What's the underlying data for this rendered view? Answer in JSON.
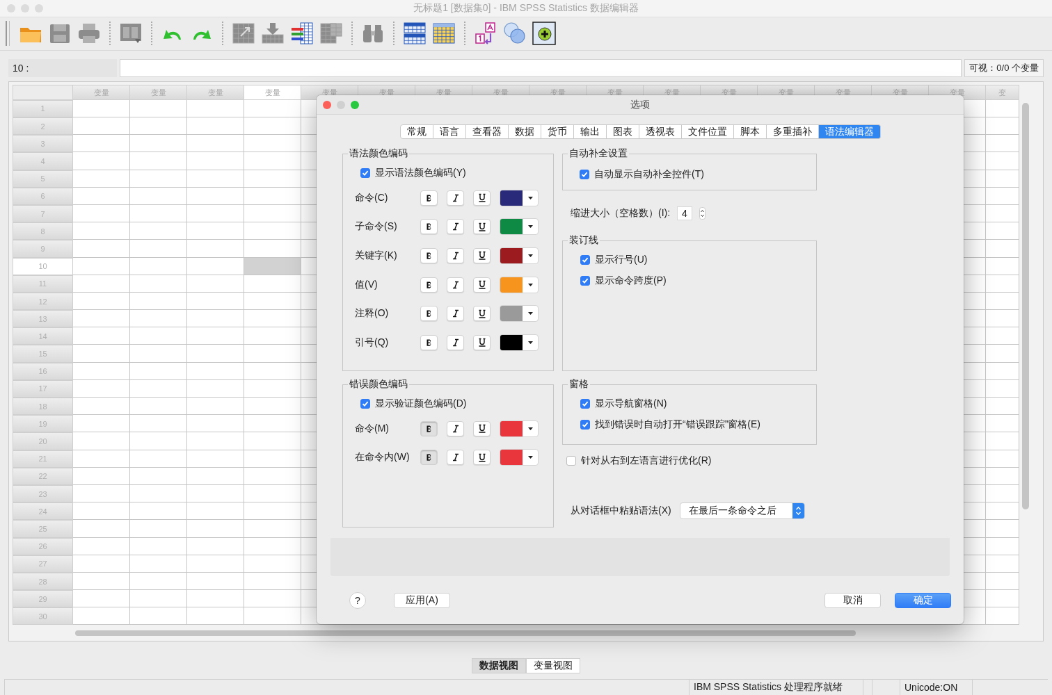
{
  "window": {
    "title": "无标题1 [数据集0] - IBM SPSS Statistics 数据编辑器"
  },
  "toolbar": [
    {
      "kind": "folder",
      "disabled": false
    },
    {
      "kind": "save",
      "disabled": true
    },
    {
      "kind": "print",
      "disabled": true
    },
    {
      "kind": "separator"
    },
    {
      "kind": "dialog",
      "disabled": true
    },
    {
      "kind": "separator"
    },
    {
      "kind": "undo",
      "disabled": false
    },
    {
      "kind": "redo",
      "disabled": false
    },
    {
      "kind": "separator"
    },
    {
      "kind": "goto",
      "disabled": true
    },
    {
      "kind": "insert",
      "disabled": true
    },
    {
      "kind": "variables",
      "disabled": false
    },
    {
      "kind": "split",
      "disabled": true
    },
    {
      "kind": "separator"
    },
    {
      "kind": "find",
      "disabled": true
    },
    {
      "kind": "separator"
    },
    {
      "kind": "table",
      "disabled": false
    },
    {
      "kind": "sheet",
      "disabled": false
    },
    {
      "kind": "separator"
    },
    {
      "kind": "labels",
      "disabled": false
    },
    {
      "kind": "sets",
      "disabled": false
    },
    {
      "kind": "addon",
      "disabled": false
    }
  ],
  "cell_bar": {
    "cell_ref": "10 :",
    "visible": "可视：0/0 个变量"
  },
  "grid": {
    "columns": [
      {
        "label": "变量",
        "selected": false
      },
      {
        "label": "变量",
        "selected": false
      },
      {
        "label": "变量",
        "selected": false
      },
      {
        "label": "变量",
        "selected": true
      },
      {
        "label": "变量",
        "selected": false
      },
      {
        "label": "变量",
        "selected": false
      },
      {
        "label": "变量",
        "selected": false
      },
      {
        "label": "变量",
        "selected": false
      },
      {
        "label": "变量",
        "selected": false
      },
      {
        "label": "变量",
        "selected": false
      },
      {
        "label": "变量",
        "selected": false
      },
      {
        "label": "变量",
        "selected": false
      },
      {
        "label": "变量",
        "selected": false
      },
      {
        "label": "变量",
        "selected": false
      },
      {
        "label": "变量",
        "selected": false
      },
      {
        "label": "变量",
        "selected": false
      },
      {
        "label": "变",
        "selected": false
      }
    ],
    "rows": [
      {
        "label": "1",
        "selected": false
      },
      {
        "label": "2",
        "selected": false
      },
      {
        "label": "3",
        "selected": false
      },
      {
        "label": "4",
        "selected": false
      },
      {
        "label": "5",
        "selected": false
      },
      {
        "label": "6",
        "selected": false
      },
      {
        "label": "7",
        "selected": false
      },
      {
        "label": "8",
        "selected": false
      },
      {
        "label": "9",
        "selected": false
      },
      {
        "label": "10",
        "selected": true
      },
      {
        "label": "11",
        "selected": false
      },
      {
        "label": "12",
        "selected": false
      },
      {
        "label": "13",
        "selected": false
      },
      {
        "label": "14",
        "selected": false
      },
      {
        "label": "15",
        "selected": false
      },
      {
        "label": "16",
        "selected": false
      },
      {
        "label": "17",
        "selected": false
      },
      {
        "label": "18",
        "selected": false
      },
      {
        "label": "19",
        "selected": false
      },
      {
        "label": "20",
        "selected": false
      },
      {
        "label": "21",
        "selected": false
      },
      {
        "label": "22",
        "selected": false
      },
      {
        "label": "23",
        "selected": false
      },
      {
        "label": "24",
        "selected": false
      },
      {
        "label": "25",
        "selected": false
      },
      {
        "label": "26",
        "selected": false
      },
      {
        "label": "27",
        "selected": false
      },
      {
        "label": "28",
        "selected": false
      },
      {
        "label": "29",
        "selected": false
      },
      {
        "label": "30",
        "selected": false
      }
    ]
  },
  "dialog": {
    "title": "选项",
    "tabs": [
      {
        "label": "常规",
        "selected": false
      },
      {
        "label": "语言",
        "selected": false
      },
      {
        "label": "查看器",
        "selected": false
      },
      {
        "label": "数据",
        "selected": false
      },
      {
        "label": "货币",
        "selected": false
      },
      {
        "label": "输出",
        "selected": false
      },
      {
        "label": "图表",
        "selected": false
      },
      {
        "label": "透视表",
        "selected": false
      },
      {
        "label": "文件位置",
        "selected": false
      },
      {
        "label": "脚本",
        "selected": false
      },
      {
        "label": "多重插补",
        "selected": false
      },
      {
        "label": "语法编辑器",
        "selected": true
      }
    ],
    "syntax_coloring": {
      "title": "语法颜色编码",
      "checkbox": {
        "label": "显示语法颜色编码(Y)",
        "checked": true
      },
      "rows": [
        {
          "label": "命令(C)",
          "bold": false,
          "italic": false,
          "underline": false,
          "color": "#2a2a7a"
        },
        {
          "label": "子命令(S)",
          "bold": false,
          "italic": false,
          "underline": false,
          "color": "#0e8a45"
        },
        {
          "label": "关键字(K)",
          "bold": false,
          "italic": false,
          "underline": false,
          "color": "#9b1b1e"
        },
        {
          "label": "值(V)",
          "bold": false,
          "italic": false,
          "underline": false,
          "color": "#f7941d"
        },
        {
          "label": "注释(O)",
          "bold": false,
          "italic": false,
          "underline": false,
          "color": "#9a9a9a"
        },
        {
          "label": "引号(Q)",
          "bold": false,
          "italic": false,
          "underline": false,
          "color": "#000000"
        }
      ]
    },
    "error_coloring": {
      "title": "错误颜色编码",
      "checkbox": {
        "label": "显示验证颜色编码(D)",
        "checked": true
      },
      "rows": [
        {
          "label": "命令(M)",
          "bold": true,
          "italic": false,
          "underline": false,
          "color": "#e8363c"
        },
        {
          "label": "在命令内(W)",
          "bold": true,
          "italic": false,
          "underline": false,
          "color": "#e8363c"
        }
      ]
    },
    "autocomplete": {
      "title": "自动补全设置",
      "checkbox": {
        "label": "自动显示自动补全控件(T)",
        "checked": true
      }
    },
    "indent": {
      "label": "缩进大小（空格数）(I):",
      "value": "4"
    },
    "gutter": {
      "title": "装订线",
      "checkboxes": [
        {
          "label": "显示行号(U)",
          "checked": true
        },
        {
          "label": "显示命令跨度(P)",
          "checked": true
        }
      ]
    },
    "panes": {
      "title": "窗格",
      "checkboxes": [
        {
          "label": "显示导航窗格(N)",
          "checked": true
        },
        {
          "label": "找到错误时自动打开“错误跟踪”窗格(E)",
          "checked": true
        }
      ]
    },
    "rtl": {
      "label": "针对从右到左语言进行优化(R)",
      "checked": false
    },
    "paste": {
      "label": "从对话框中粘贴语法(X)",
      "value": "在最后一条命令之后"
    },
    "help": "?",
    "buttons": [
      {
        "label": "应用(A)",
        "kind": "apply"
      },
      {
        "label": "取消",
        "kind": "cancel"
      },
      {
        "label": "确定",
        "kind": "default"
      }
    ]
  },
  "view_tabs": [
    {
      "label": "数据视图",
      "selected": true
    },
    {
      "label": "变量视图",
      "selected": false
    }
  ],
  "status_bar": [
    "IBM SPSS Statistics 处理程序就绪",
    "Unicode:ON"
  ]
}
